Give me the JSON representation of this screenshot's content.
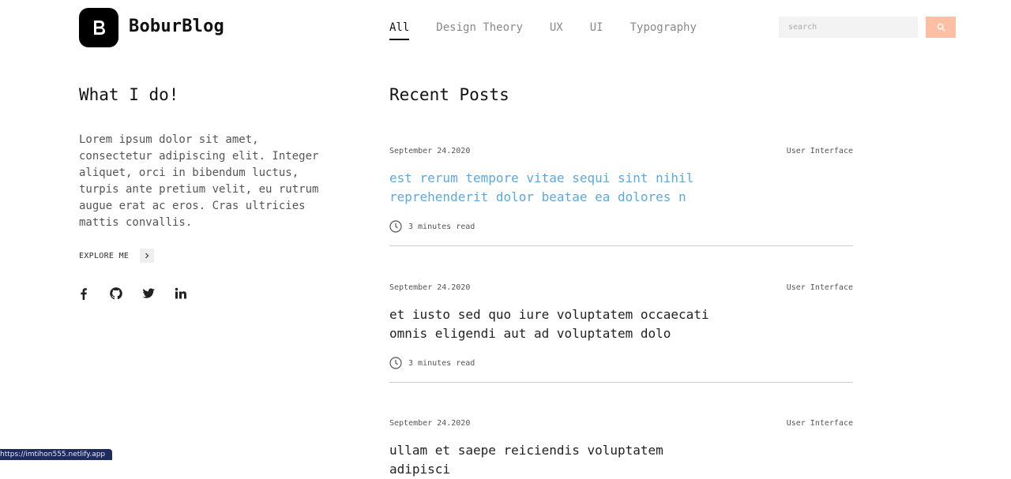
{
  "header": {
    "brand": "BoburBlog",
    "nav": [
      "All",
      "Design Theory",
      "UX",
      "UI",
      "Typography"
    ],
    "active_nav": "All",
    "search_placeholder": "search"
  },
  "sidebar": {
    "title": "What I do!",
    "intro": "Lorem ipsum dolor sit amet, consectetur adipiscing elit. Integer aliquet, orci in bibendum luctus, turpis ante pretium velit, eu rutrum augue erat ac eros. Cras ultricies mattis convallis.",
    "explore_label": "EXPLORE ME",
    "socials": [
      "facebook-icon",
      "github-icon",
      "twitter-icon",
      "linkedin-icon"
    ]
  },
  "main": {
    "title": "Recent Posts",
    "posts": [
      {
        "date": "September 24.2020",
        "category": "User Interface",
        "title": "est rerum tempore vitae sequi sint nihil reprehenderit dolor beatae ea dolores n",
        "read_time": "3 minutes read"
      },
      {
        "date": "September 24.2020",
        "category": "User Interface",
        "title": "et iusto sed quo iure voluptatem occaecati omnis eligendi aut ad voluptatem dolo",
        "read_time": "3 minutes read"
      },
      {
        "date": "September 24.2020",
        "category": "User Interface",
        "title": "ullam et saepe reiciendis voluptatem adipisci",
        "read_time": "3 minutes read"
      }
    ]
  },
  "status_bar": {
    "url": "https://imtihon555.netlify.app"
  },
  "colors": {
    "accent": "#fdbfa4",
    "link_highlight": "#5aa9e0",
    "status_bar": "#1e2b5e"
  }
}
